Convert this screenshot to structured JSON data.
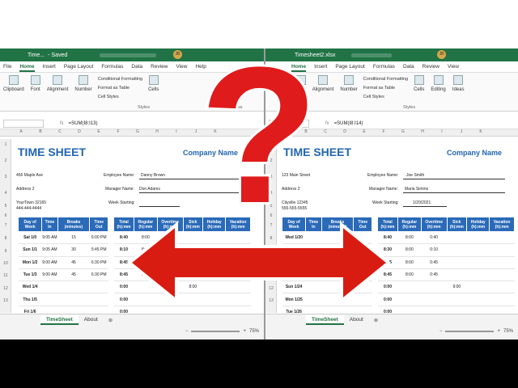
{
  "left": {
    "titlebar": {
      "file": "Time...",
      "saved": "- Saved",
      "avatar": "JB"
    },
    "menu": [
      "File",
      "Home",
      "Insert",
      "Page Layout",
      "Formulas",
      "Data",
      "Review",
      "View",
      "Help"
    ],
    "active_menu": "Home",
    "ribbon": {
      "groups": [
        "Clipboard",
        "Font",
        "Alignment",
        "Number"
      ],
      "styles": [
        "Conditional Formatting",
        "Format as Table",
        "Cell Styles"
      ],
      "styles_caption": "Styles",
      "cells": "Cells",
      "ideas": "Ideas"
    },
    "formula": "=SUM(I8:I13)",
    "columns": [
      "A",
      "B",
      "C",
      "D",
      "E",
      "F",
      "G",
      "H",
      "I",
      "J",
      "K"
    ],
    "rows": [
      "1",
      "2",
      "3",
      "4",
      "5",
      "6",
      "7",
      "8",
      "9",
      "10",
      "11",
      "12",
      "13",
      "14"
    ],
    "sheet": {
      "title": "TIME SHEET",
      "company": "Company Name",
      "addr1": "456 Maple Ave",
      "addr2": "Address 2",
      "addr3": "YourTown 32165",
      "addr4": "444-444-4444",
      "emp_label": "Employee Name:",
      "emp": "Danny Brown",
      "mgr_label": "Manager Name:",
      "mgr": "Don Adams",
      "week_label": "Week Starting:",
      "week": "",
      "left_headers": [
        "Day of Week",
        "Time In",
        "Breaks (minutes)",
        "Time Out"
      ],
      "left_rows": [
        [
          "Sat 1/0",
          "9:05 AM",
          "15",
          "6:00 PM"
        ],
        [
          "Sun 1/1",
          "9:05 AM",
          "30",
          "5:45 PM"
        ],
        [
          "Mon 1/2",
          "9:00 AM",
          "45",
          "6:30 PM"
        ],
        [
          "Tue 1/3",
          "9:00 AM",
          "45",
          "6:30 PM"
        ],
        [
          "Wed 1/4",
          "",
          "",
          ""
        ],
        [
          "Thu 1/5",
          "",
          "",
          ""
        ],
        [
          "Fri 1/6",
          "",
          "",
          ""
        ]
      ],
      "right_headers": [
        "Total (h):mm",
        "Regular (h):mm",
        "Overtime (h):mm",
        "Sick (h):mm",
        "Holiday (h):mm",
        "Vacation (h):mm"
      ],
      "right_rows": [
        [
          "8:40",
          "8:00",
          "0:40",
          "",
          "",
          ""
        ],
        [
          "8:10",
          "8:00",
          "",
          "",
          "",
          ""
        ],
        [
          "8:45",
          "8:00",
          "0:45",
          "",
          "",
          ""
        ],
        [
          "8:45",
          "8:00",
          "0:45",
          "",
          "",
          ""
        ],
        [
          "0:00",
          "",
          "",
          "8:00",
          "",
          ""
        ],
        [
          "0:00",
          "",
          "",
          "",
          "",
          ""
        ],
        [
          "0:00",
          "",
          "",
          "",
          "",
          ""
        ]
      ]
    },
    "tabs": [
      "TimeSheet",
      "About"
    ],
    "zoom": "75%"
  },
  "right": {
    "titlebar": {
      "file": "Timesheet2.xlsx",
      "avatar": "JB"
    },
    "menu": [
      "Home",
      "Insert",
      "Page Layout",
      "Formulas",
      "Data",
      "Review",
      "View"
    ],
    "active_menu": "Home",
    "ribbon": {
      "groups": [
        "Clipboard",
        "Font",
        "Alignment",
        "Number"
      ],
      "styles": [
        "Conditional Formatting",
        "Format as Table",
        "Cell Styles"
      ],
      "styles_caption": "Styles",
      "cells": "Cells",
      "editing": "Editing",
      "ideas": "Ideas"
    },
    "formula": "=SUM(I8:I14)",
    "columns": [
      "A",
      "B",
      "C",
      "D",
      "E",
      "F",
      "G",
      "H",
      "I",
      "J",
      "K"
    ],
    "rows": [
      "1",
      "2",
      "3",
      "4",
      "5",
      "6",
      "7",
      "8",
      "9",
      "10",
      "11",
      "12",
      "13",
      "14"
    ],
    "sheet": {
      "title": "TIME SHEET",
      "company": "Company Name",
      "addr1": "123 Main Street",
      "addr2": "Address 2",
      "addr3": "Cityville 12345",
      "addr4": "555-555-5555",
      "emp_label": "Employee Name:",
      "emp": "Joe Smith",
      "mgr_label": "Manager Name:",
      "mgr": "Maria Simms",
      "week_label": "Week Starting:",
      "week": "1/20/2021",
      "left_headers": [
        "Day of Week",
        "Time In",
        "Breaks (minutes)",
        "Time Out"
      ],
      "left_rows": [
        [
          "Wed 1/20",
          "",
          "",
          ""
        ],
        [
          "",
          "",
          "",
          ""
        ],
        [
          "",
          "",
          "",
          ""
        ],
        [
          "",
          "",
          "",
          ""
        ],
        [
          "Sun 1/24",
          "",
          "",
          ""
        ],
        [
          "Mon 1/25",
          "",
          "",
          ""
        ],
        [
          "Tue 1/26",
          "",
          "",
          ""
        ]
      ],
      "right_headers": [
        "Total (h):mm",
        "Regular (h):mm",
        "Overtime (h):mm",
        "Sick (h):mm",
        "Holiday (h):mm",
        "Vacation (h):mm"
      ],
      "right_rows": [
        [
          "8:40",
          "8:00",
          "0:40",
          "",
          "",
          ""
        ],
        [
          "8:30",
          "8:00",
          "0:10",
          "",
          "",
          ""
        ],
        [
          "8:15",
          "8:00",
          "0:45",
          "",
          "",
          ""
        ],
        [
          "8:45",
          "8:00",
          "0:45",
          "",
          "",
          ""
        ],
        [
          "0:00",
          "",
          "",
          "9:00",
          "",
          ""
        ],
        [
          "0:00",
          "",
          "",
          "",
          "",
          ""
        ],
        [
          "0:00",
          "",
          "",
          "",
          "",
          ""
        ]
      ]
    },
    "tabs": [
      "TimeSheet",
      "About"
    ],
    "zoom": "75%"
  },
  "overlay": {
    "question_mark": "?",
    "arrow": "left-right-arrow",
    "question_color": "#e01b1b",
    "arrow_color": "#d91c12"
  }
}
